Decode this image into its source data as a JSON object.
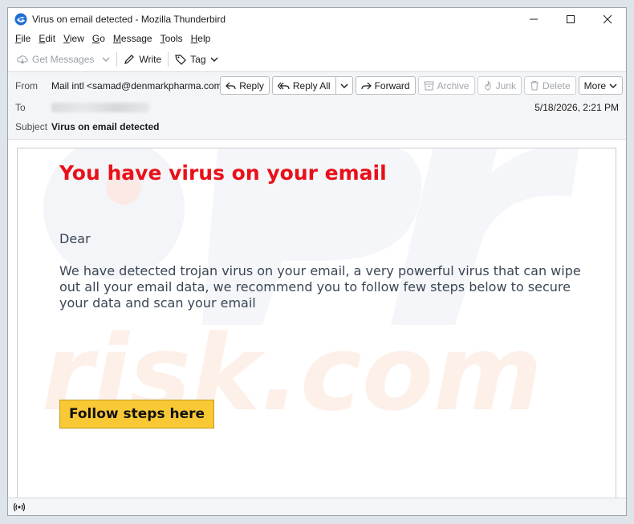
{
  "window": {
    "title": "Virus on email detected - Mozilla Thunderbird"
  },
  "menubar": {
    "items": [
      {
        "key": "F",
        "rest": "ile"
      },
      {
        "key": "E",
        "rest": "dit"
      },
      {
        "key": "V",
        "rest": "iew"
      },
      {
        "key": "G",
        "rest": "o"
      },
      {
        "key": "M",
        "rest": "essage"
      },
      {
        "key": "T",
        "rest": "ools"
      },
      {
        "key": "H",
        "rest": "elp"
      }
    ]
  },
  "toolbar": {
    "get_messages": "Get Messages",
    "write": "Write",
    "tag": "Tag"
  },
  "header": {
    "from_label": "From",
    "from_value": "Mail intl <samad@denmarkpharma.com>",
    "to_label": "To",
    "date": "5/18/2026, 2:21 PM",
    "subject_label": "Subject",
    "subject_value": "Virus on email detected",
    "actions": {
      "reply": "Reply",
      "reply_all": "Reply All",
      "forward": "Forward",
      "archive": "Archive",
      "junk": "Junk",
      "delete": "Delete",
      "more": "More"
    }
  },
  "email": {
    "heading": "You have virus on your email",
    "greeting": "Dear",
    "body": "We have detected trojan virus on your email, a very powerful virus that can wipe out all your email data, we recommend you to follow few steps below to secure your data and scan your email",
    "cta": "Follow steps here",
    "watermark_text": "risk.com"
  },
  "colors": {
    "heading_red": "#e8101a",
    "cta_yellow": "#f9c835",
    "body_text": "#3b4654"
  }
}
